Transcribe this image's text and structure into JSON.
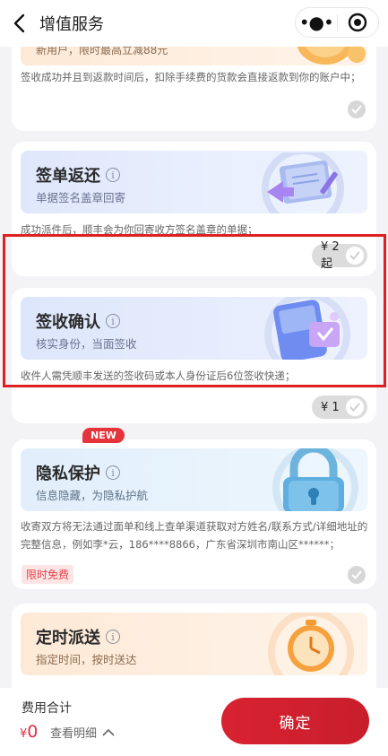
{
  "header": {
    "title": "增值服务",
    "menu_icon": "more-dots-icon",
    "target_icon": "target-icon"
  },
  "cards": [
    {
      "id": "top-partial",
      "banner_sub": "新用户，限时最高立减88元",
      "desc": "签收成功并且到返款时间后，扣除手续费的货款会直接返款到你的账户中；",
      "checked": false
    },
    {
      "id": "sign-return",
      "title": "签单返还",
      "subtitle": "单据签名盖章回寄",
      "desc": "成功派件后，顺丰会为你回寄收方签名盖章的单据；",
      "price": "¥ 2起",
      "checked": false
    },
    {
      "id": "sign-confirm",
      "title": "签收确认",
      "subtitle": "核实身份，当面签收",
      "desc": "收件人需凭顺丰发送的签收码或本人身份证后6位签收快递；",
      "price": "¥ 1",
      "checked": false
    },
    {
      "id": "privacy",
      "badge": "NEW",
      "title": "隐私保护",
      "subtitle": "信息隐藏，为隐私护航",
      "desc": "收寄双方将无法通过面单和线上查单渠道获取对方姓名/联系方式/详细地址的完整信息，例如李*云，186****8866，广东省深圳市南山区******；",
      "tag": "限时免费",
      "checked": false
    },
    {
      "id": "timed-delivery",
      "title": "定时派送",
      "subtitle": "指定时间，按时送达"
    }
  ],
  "footer": {
    "fee_label": "费用合计",
    "currency": "¥",
    "amount": "0",
    "detail_label": "查看明细",
    "confirm_label": "确定"
  },
  "colors": {
    "accent": "#d82231",
    "highlight_border": "#e02020"
  }
}
